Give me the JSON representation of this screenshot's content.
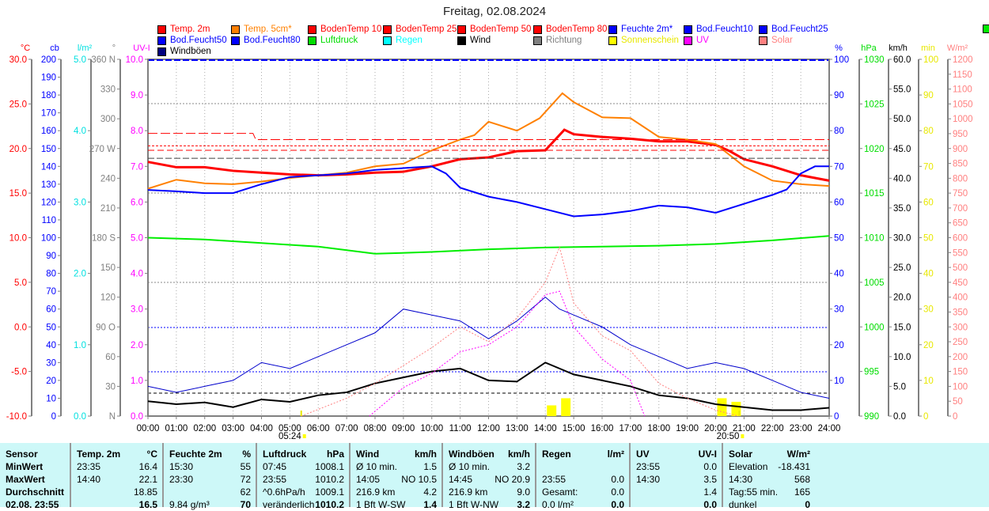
{
  "title": "Freitag, 02.08.2024",
  "legend": [
    {
      "label": "Temp. 2m",
      "color": "#ff0000"
    },
    {
      "label": "Temp. 5cm*",
      "color": "#ff8000"
    },
    {
      "label": "BodenTemp 10",
      "color": "#ff0000"
    },
    {
      "label": "BodenTemp 25",
      "color": "#ff0000"
    },
    {
      "label": "BodenTemp 50",
      "color": "#ff0000"
    },
    {
      "label": "BodenTemp 80",
      "color": "#ff0000"
    },
    {
      "label": "Feuchte 2m*",
      "color": "#0000ff"
    },
    {
      "label": "Bod.Feucht10",
      "color": "#0000ff"
    },
    {
      "label": "Bod.Feucht25",
      "color": "#0000ff"
    },
    {
      "label": "Bod.Feucht50",
      "color": "#0000ff"
    },
    {
      "label": "Bod.Feucht80",
      "color": "#0000ff"
    },
    {
      "label": "Luftdruck",
      "color": "#00dd00"
    },
    {
      "label": "Regen",
      "color": "#00ffff"
    },
    {
      "label": "Wind",
      "color": "#000000"
    },
    {
      "label": "Richtung",
      "color": "#808080"
    },
    {
      "label": "Sonnenschein",
      "color": "#ffff00"
    },
    {
      "label": "UV",
      "color": "#ff00ff"
    },
    {
      "label": "Solar",
      "color": "#ff8080"
    },
    {
      "label": "Windböen",
      "color": "#000080"
    }
  ],
  "chart_data": {
    "type": "line",
    "title": "Freitag, 02.08.2024",
    "x_label_ticks": [
      "00:00",
      "01:00",
      "02:00",
      "03:00",
      "04:00",
      "05:00",
      "06:00",
      "07:00",
      "08:00",
      "09:00",
      "10:00",
      "11:00",
      "12:00",
      "13:00",
      "14:00",
      "15:00",
      "16:00",
      "17:00",
      "18:00",
      "19:00",
      "20:00",
      "21:00",
      "22:00",
      "23:00",
      "24:00"
    ],
    "sunrise": "05:24",
    "sunset": "20:50",
    "axes_left": [
      {
        "unit": "°C",
        "color": "#ff0000",
        "min": -10,
        "max": 30,
        "labels": [
          "30.0",
          "25.0",
          "20.0",
          "15.0",
          "10.0",
          "5.0",
          "0.0",
          "-5.0",
          "-10.0"
        ]
      },
      {
        "unit": "cb",
        "color": "#0000ff",
        "min": 0,
        "max": 200,
        "labels": [
          "200",
          "190",
          "180",
          "170",
          "160",
          "150",
          "140",
          "130",
          "120",
          "110",
          "100",
          "90",
          "80",
          "70",
          "60",
          "50",
          "40",
          "30",
          "20",
          "10",
          "0"
        ]
      },
      {
        "unit": "l/m²",
        "color": "#00e0e0",
        "min": 0,
        "max": 5,
        "labels": [
          "5.0",
          "4.0",
          "3.0",
          "2.0",
          "1.0",
          "0.0"
        ]
      },
      {
        "unit": "°",
        "color": "#808080",
        "min": 0,
        "max": 360,
        "labels": [
          "360 N",
          "330",
          "300",
          "270 W",
          "240",
          "210",
          "180 S",
          "150",
          "120",
          "90  O",
          "60",
          "30",
          "N"
        ]
      },
      {
        "unit": "UV-I",
        "color": "#ff00ff",
        "min": 0,
        "max": 10,
        "labels": [
          "10.0",
          "9.0",
          "8.0",
          "7.0",
          "6.0",
          "5.0",
          "4.0",
          "3.0",
          "2.0",
          "1.0",
          "0.0"
        ]
      }
    ],
    "axes_right": [
      {
        "unit": "%",
        "color": "#0000ff",
        "min": 0,
        "max": 100,
        "labels": [
          "100",
          "90",
          "80",
          "70",
          "60",
          "50",
          "40",
          "30",
          "20",
          "10",
          "0"
        ]
      },
      {
        "unit": "hPa",
        "color": "#00dd00",
        "min": 990,
        "max": 1030,
        "labels": [
          "1030",
          "1025",
          "1020",
          "1015",
          "1010",
          "1005",
          "1000",
          "995",
          "990"
        ]
      },
      {
        "unit": "km/h",
        "color": "#000000",
        "min": 0,
        "max": 60,
        "labels": [
          "60.0",
          "55.0",
          "50.0",
          "45.0",
          "40.0",
          "35.0",
          "30.0",
          "25.0",
          "20.0",
          "15.0",
          "10.0",
          "5.0",
          "0.0"
        ]
      },
      {
        "unit": "min",
        "color": "#e8e800",
        "min": 0,
        "max": 100,
        "labels": [
          "100",
          "90",
          "80",
          "70",
          "60",
          "50",
          "40",
          "30",
          "20",
          "10",
          "0"
        ]
      },
      {
        "unit": "W/m²",
        "color": "#ff8080",
        "min": 0,
        "max": 1200,
        "labels": [
          "1200",
          "1150",
          "1100",
          "1050",
          "1000",
          "950",
          "900",
          "850",
          "800",
          "750",
          "700",
          "650",
          "600",
          "550",
          "500",
          "450",
          "400",
          "350",
          "300",
          "250",
          "200",
          "150",
          "100",
          "50",
          "0"
        ]
      }
    ],
    "series": [
      {
        "name": "Temp. 2m",
        "axis": "°C",
        "color": "#ff0000",
        "width": 3,
        "x": [
          0,
          1,
          2,
          3,
          4,
          5,
          6,
          7,
          8,
          9,
          10,
          11,
          12,
          13,
          14,
          14.67,
          15,
          16,
          17,
          18,
          19,
          20,
          20.5,
          21,
          22,
          23,
          24
        ],
        "y": [
          18.5,
          17.9,
          17.9,
          17.5,
          17.3,
          17.1,
          17.0,
          17.1,
          17.3,
          17.4,
          18.0,
          18.8,
          19.0,
          19.7,
          19.8,
          22.1,
          21.6,
          21.3,
          21.1,
          20.8,
          20.8,
          20.4,
          19.7,
          18.8,
          18.0,
          17.0,
          16.4
        ]
      },
      {
        "name": "Temp. 5cm*",
        "axis": "°C",
        "color": "#ff8000",
        "width": 2,
        "x": [
          0,
          1,
          2,
          3,
          4,
          5,
          6,
          7,
          8,
          9,
          10,
          11,
          11.5,
          12,
          13,
          13.8,
          14.6,
          15,
          16,
          17,
          18,
          19,
          20,
          21,
          22,
          23,
          24
        ],
        "y": [
          15.5,
          16.5,
          16.1,
          16.0,
          16.3,
          16.7,
          17.0,
          17.3,
          18.0,
          18.3,
          19.8,
          21.0,
          21.5,
          23.0,
          22.0,
          23.4,
          26.2,
          25.2,
          23.5,
          23.4,
          21.3,
          21.0,
          20.5,
          18.0,
          16.4,
          16.0,
          15.8
        ]
      },
      {
        "name": "BodenTemp 10",
        "axis": "°C",
        "color": "#ff0000",
        "width": 1,
        "dash": "12 4",
        "x": [
          0,
          3.7,
          3.8,
          24
        ],
        "y": [
          21.7,
          21.7,
          21.0,
          21.0
        ]
      },
      {
        "name": "BodenTemp 25",
        "axis": "°C",
        "color": "#ff0000",
        "width": 1,
        "dash": "3 2",
        "x": [
          0,
          24
        ],
        "y": [
          20.3,
          20.3
        ]
      },
      {
        "name": "BodenTemp 50",
        "axis": "°C",
        "color": "#ff0000",
        "width": 1,
        "dash": "8 4",
        "x": [
          0,
          24
        ],
        "y": [
          19.8,
          19.8
        ]
      },
      {
        "name": "BodenTemp 80",
        "axis": "°C",
        "color": "#404040",
        "width": 1,
        "dash": "8 3",
        "x": [
          0,
          24
        ],
        "y": [
          18.9,
          18.9
        ]
      },
      {
        "name": "Feuchte 2m*",
        "axis": "%",
        "color": "#0000ff",
        "width": 2,
        "x": [
          0,
          1,
          2,
          3,
          4,
          5,
          6,
          7,
          8,
          9,
          10,
          10.5,
          11,
          12,
          13,
          14,
          15,
          16,
          17,
          18,
          19,
          20,
          21,
          22,
          22.5,
          23,
          23.5,
          24
        ],
        "y": [
          63.4,
          63,
          62.5,
          62.5,
          65,
          67,
          67.5,
          68,
          69,
          69.5,
          70,
          68,
          64,
          61.5,
          60,
          58,
          56,
          56.5,
          57.5,
          59,
          58.5,
          57,
          59.5,
          62,
          63.5,
          68,
          70,
          70
        ]
      },
      {
        "name": "Luftdruck",
        "axis": "hPa",
        "color": "#00ee00",
        "width": 2,
        "x": [
          0,
          2,
          4,
          6,
          8,
          10,
          12,
          14,
          16,
          18,
          20,
          22,
          24
        ],
        "y": [
          1010.0,
          1009.8,
          1009.4,
          1009.0,
          1008.2,
          1008.4,
          1008.7,
          1008.9,
          1009.0,
          1009.1,
          1009.3,
          1009.7,
          1010.2
        ]
      },
      {
        "name": "Windböen",
        "axis": "km/h",
        "color": "#0000cc",
        "width": 1,
        "x": [
          0,
          1,
          2,
          3,
          4,
          5,
          6,
          7,
          8,
          9,
          10,
          11,
          12,
          13,
          14,
          14.5,
          15,
          16,
          17,
          18,
          19,
          20,
          21,
          22,
          23,
          24
        ],
        "y": [
          5,
          4,
          5,
          6,
          9,
          8,
          10,
          12,
          14,
          18,
          17,
          16,
          13,
          16,
          20,
          18,
          17,
          15,
          12,
          10,
          8,
          9,
          8,
          6,
          4,
          3
        ]
      },
      {
        "name": "Wind",
        "axis": "km/h",
        "color": "#000000",
        "width": 2,
        "x": [
          0,
          1,
          2,
          3,
          4,
          5,
          6,
          7,
          8,
          9,
          10,
          11,
          12,
          13,
          14,
          14.5,
          15,
          16,
          17,
          18,
          19,
          20,
          21,
          22,
          23,
          24
        ],
        "y": [
          2.5,
          2.0,
          2.3,
          1.5,
          2.8,
          2.4,
          3.5,
          4.0,
          5.5,
          6.5,
          7.5,
          8.0,
          6.0,
          5.8,
          9.0,
          8.0,
          7.0,
          6.0,
          5.0,
          3.5,
          3.0,
          2.0,
          1.5,
          1.0,
          1.0,
          1.4
        ]
      },
      {
        "name": "Solar",
        "axis": "W/m²",
        "color": "#ff8080",
        "width": 1,
        "dash": "2 2",
        "x": [
          5.4,
          7,
          8,
          9,
          10,
          11,
          12,
          13,
          14,
          14.5,
          15,
          16,
          17,
          18,
          19,
          20,
          20.8
        ],
        "y": [
          0,
          60,
          110,
          170,
          230,
          300,
          250,
          330,
          450,
          568,
          380,
          270,
          220,
          110,
          60,
          20,
          0
        ]
      },
      {
        "name": "UV",
        "axis": "UV-I",
        "color": "#ff00ff",
        "width": 1,
        "dash": "2 2",
        "x": [
          7.8,
          9,
          10,
          11,
          12,
          13,
          14,
          14.5,
          15,
          16,
          17,
          17.5
        ],
        "y": [
          0,
          0.8,
          1.2,
          1.8,
          2.0,
          2.5,
          3.4,
          3.5,
          2.5,
          1.6,
          1.0,
          0
        ]
      }
    ],
    "sunshine_minutes": [
      {
        "x": 14.0,
        "v": 3
      },
      {
        "x": 14.5,
        "v": 5
      },
      {
        "x": 20.0,
        "v": 5
      },
      {
        "x": 20.5,
        "v": 4
      }
    ]
  },
  "table": [
    {
      "h": [
        "Sensor",
        ""
      ],
      "rows": [
        [
          "MinWert",
          ""
        ],
        [
          "MaxWert",
          ""
        ],
        [
          "Durchschnitt",
          ""
        ],
        [
          "02.08. 23:55",
          ""
        ]
      ],
      "boldLeft": true
    },
    {
      "h": [
        "Temp. 2m",
        "°C"
      ],
      "rows": [
        [
          "23:35",
          "16.4"
        ],
        [
          "14:40",
          "22.1"
        ],
        [
          "",
          "18.85"
        ],
        [
          "",
          "16.5"
        ]
      ]
    },
    {
      "h": [
        "Feuchte 2m",
        "%"
      ],
      "rows": [
        [
          "15:30",
          "55"
        ],
        [
          "23:30",
          "72"
        ],
        [
          "",
          "62"
        ],
        [
          "9.84 g/m³",
          "70"
        ]
      ]
    },
    {
      "h": [
        "Luftdruck",
        "hPa"
      ],
      "rows": [
        [
          "07:45",
          "1008.1"
        ],
        [
          "23:55",
          "1010.2"
        ],
        [
          "^0.6hPa/h",
          "1009.1"
        ],
        [
          "veränderlich",
          "1010.2"
        ]
      ]
    },
    {
      "h": [
        "Wind",
        "km/h"
      ],
      "rows": [
        [
          "Ø 10 min.",
          "1.5"
        ],
        [
          "14:05",
          "NO 10.5"
        ],
        [
          "216.9 km",
          "4.2"
        ],
        [
          "1 Bft W-SW",
          "1.4"
        ]
      ]
    },
    {
      "h": [
        "Windböen",
        "km/h"
      ],
      "rows": [
        [
          "Ø 10 min.",
          "3.2"
        ],
        [
          "14:45",
          "NO 20.9"
        ],
        [
          "216.9 km",
          "9.0"
        ],
        [
          "1 Bft W-NW",
          "3.2"
        ]
      ]
    },
    {
      "h": [
        "Regen",
        "l/m²"
      ],
      "rows": [
        [
          "",
          ""
        ],
        [
          "23:55",
          "0.0"
        ],
        [
          "Gesamt:",
          "0.0"
        ],
        [
          "0.0 l/m²",
          "0.0"
        ]
      ]
    },
    {
      "h": [
        "UV",
        "UV-I"
      ],
      "rows": [
        [
          "23:55",
          "0.0"
        ],
        [
          "14:30",
          "3.5"
        ],
        [
          "",
          "1.4"
        ],
        [
          "",
          "0.0"
        ]
      ]
    },
    {
      "h": [
        "Solar",
        "W/m²"
      ],
      "rows": [
        [
          "Elevation",
          "-18.431"
        ],
        [
          "14:30",
          "568"
        ],
        [
          "Tag:55 min.",
          "165"
        ],
        [
          "dunkel",
          "0"
        ]
      ]
    }
  ]
}
